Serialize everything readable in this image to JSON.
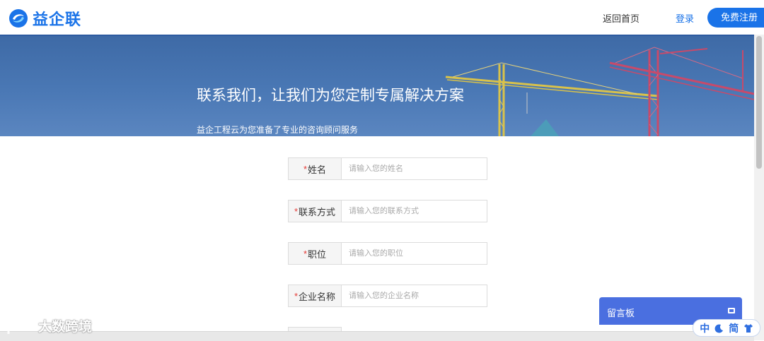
{
  "header": {
    "logo_text": "益企联",
    "nav_back": "返回首页",
    "nav_login": "登录",
    "nav_register": "免费注册"
  },
  "banner": {
    "title": "联系我们，让我们为您定制专属解决方案",
    "subtitle": "益企工程云为您准备了专业的咨询顾问服务"
  },
  "form": {
    "required_mark": "*",
    "fields": [
      {
        "label": "姓名",
        "placeholder": "请输入您的姓名"
      },
      {
        "label": "联系方式",
        "placeholder": "请输入您的联系方式"
      },
      {
        "label": "职位",
        "placeholder": "请输入您的职位"
      },
      {
        "label": "企业名称",
        "placeholder": "请输入您的企业名称"
      }
    ]
  },
  "message_board": {
    "title": "留言板"
  },
  "ime": {
    "mode": "中",
    "script": "简"
  },
  "watermark": {
    "text": "大数跨境"
  },
  "colors": {
    "brand": "#1a73e8",
    "banner": "#4a78b5",
    "message_board": "#4a6fe0",
    "required": "#e53935"
  }
}
